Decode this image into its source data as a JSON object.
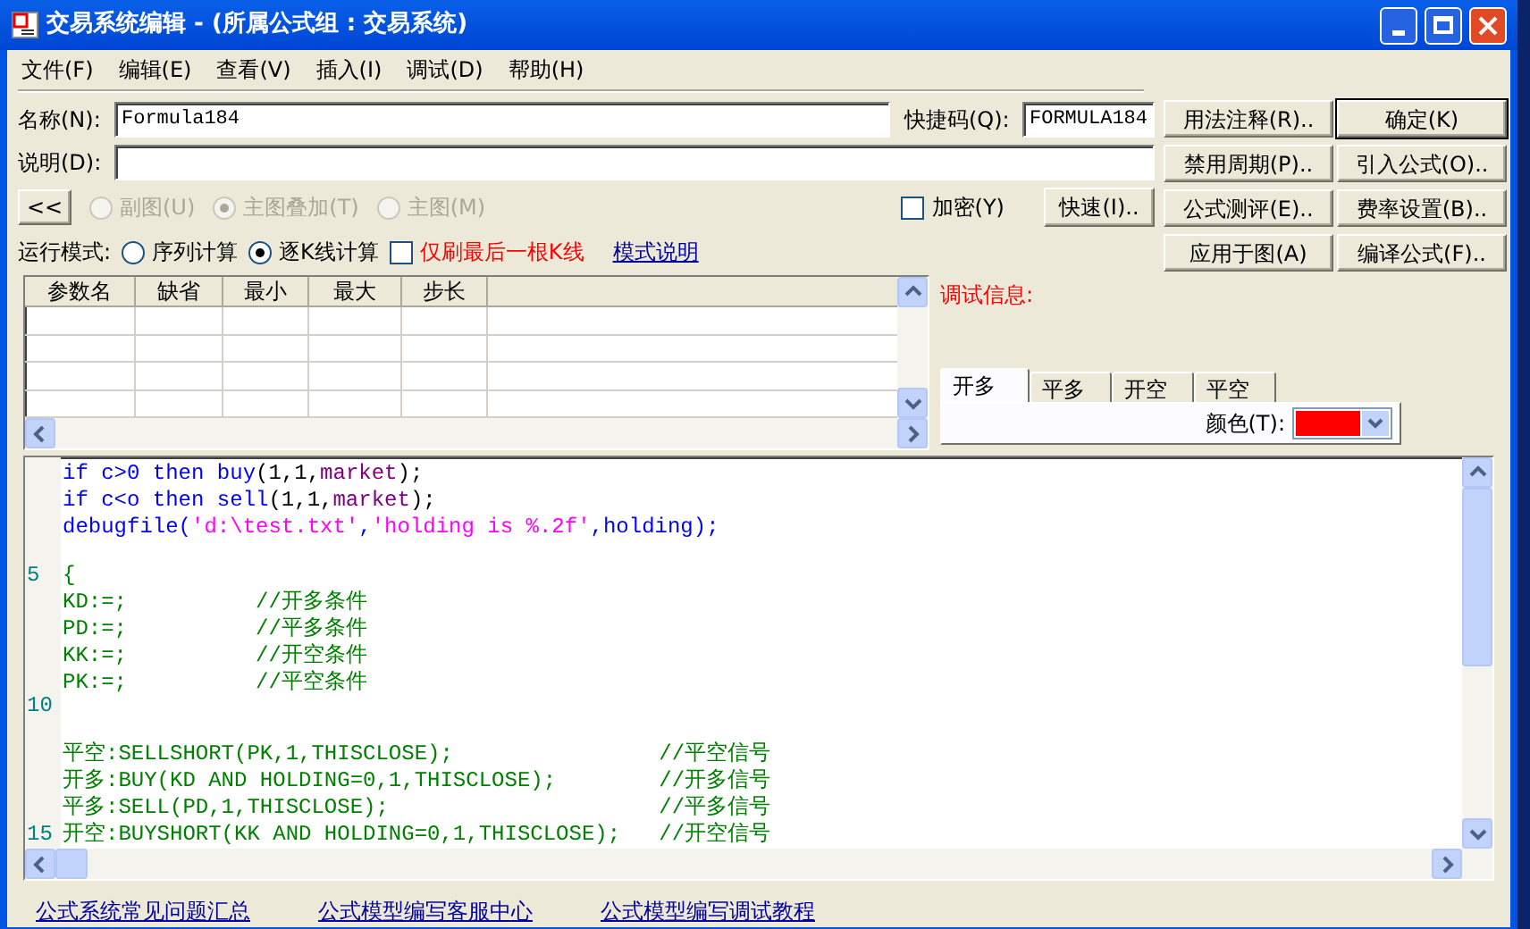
{
  "window": {
    "title": "交易系统编辑 - (所属公式组 : 交易系统)"
  },
  "menu": [
    "文件(F)",
    "编辑(E)",
    "查看(V)",
    "插入(I)",
    "调试(D)",
    "帮助(H)"
  ],
  "name_field": {
    "label": "名称(N):",
    "value": "Formula184"
  },
  "shortcut_field": {
    "label": "快捷码(Q):",
    "value": "FORMULA184"
  },
  "description_field": {
    "label": "说明(D):"
  },
  "collapse_button": "<<",
  "chart_modes": [
    {
      "label": "副图(U)",
      "selected": false,
      "disabled": true
    },
    {
      "label": "主图叠加(T)",
      "selected": true,
      "disabled": true
    },
    {
      "label": "主图(M)",
      "selected": false,
      "disabled": true
    }
  ],
  "encrypt": {
    "label": "加密(Y)",
    "checked": false
  },
  "fast_button": "快速(I)..",
  "run_mode": {
    "label": "运行模式:",
    "options": [
      {
        "label": "序列计算",
        "selected": false
      },
      {
        "label": "逐K线计算",
        "selected": true
      }
    ]
  },
  "last_bar_only": {
    "label": "仅刷最后一根K线",
    "checked": false
  },
  "mode_help_link": "模式说明",
  "right_buttons": [
    {
      "label": "用法注释(R)..",
      "default": false
    },
    {
      "label": "确定(K)",
      "default": true
    },
    {
      "label": "禁用周期(P)..",
      "default": false
    },
    {
      "label": "引入公式(O)..",
      "default": false
    },
    {
      "label": "公式测评(E)..",
      "default": false
    },
    {
      "label": "费率设置(B)..",
      "default": false
    },
    {
      "label": "应用于图(A)",
      "default": false
    },
    {
      "label": "编译公式(F)..",
      "default": false
    }
  ],
  "params_table": {
    "columns": [
      "参数名",
      "缺省",
      "最小",
      "最大",
      "步长"
    ]
  },
  "debug_label": "调试信息:",
  "signal_tabs": [
    {
      "label": "开多",
      "selected": true
    },
    {
      "label": "平多",
      "selected": false
    },
    {
      "label": "开空",
      "selected": false
    },
    {
      "label": "平空",
      "selected": false
    }
  ],
  "color_picker": {
    "label": "颜色(T):",
    "color": "#ff0000"
  },
  "editor": {
    "lines": [
      {
        "kind": "code",
        "tokens": [
          {
            "text": "if c>0 then buy",
            "kind": "keyword"
          },
          {
            "text": "(1,1,",
            "kind": "plain"
          },
          {
            "text": "market",
            "kind": "constant"
          },
          {
            "text": ");",
            "kind": "plain"
          }
        ]
      },
      {
        "kind": "code",
        "tokens": [
          {
            "text": "if c<o then sell",
            "kind": "keyword"
          },
          {
            "text": "(1,1,",
            "kind": "plain"
          },
          {
            "text": "market",
            "kind": "constant"
          },
          {
            "text": ");",
            "kind": "plain"
          }
        ]
      },
      {
        "kind": "code",
        "tokens": [
          {
            "text": "debugfile(",
            "kind": "keyword"
          },
          {
            "text": "'d:\\test.txt'",
            "kind": "string"
          },
          {
            "text": ",",
            "kind": "keyword"
          },
          {
            "text": "'holding is %.2f'",
            "kind": "string"
          },
          {
            "text": ",holding);",
            "kind": "keyword"
          }
        ]
      },
      {
        "kind": "blank"
      },
      {
        "kind": "code",
        "number": "5",
        "tokens": [
          {
            "text": "{",
            "kind": "comment"
          }
        ]
      },
      {
        "kind": "code",
        "tokens": [
          {
            "text": "KD:=;          //开多条件",
            "kind": "comment"
          }
        ]
      },
      {
        "kind": "code",
        "tokens": [
          {
            "text": "PD:=;          //平多条件",
            "kind": "comment"
          }
        ]
      },
      {
        "kind": "code",
        "tokens": [
          {
            "text": "KK:=;          //开空条件",
            "kind": "comment"
          }
        ]
      },
      {
        "kind": "code",
        "tokens": [
          {
            "text": "PK:=;          //平空条件",
            "kind": "comment"
          }
        ]
      },
      {
        "kind": "blank",
        "number": "10"
      },
      {
        "kind": "blank"
      },
      {
        "kind": "code",
        "tokens": [
          {
            "text": "平空:SELLSHORT(PK,1,THISCLOSE);                //平空信号",
            "kind": "comment"
          }
        ]
      },
      {
        "kind": "code",
        "tokens": [
          {
            "text": "开多:BUY(KD AND HOLDING=0,1,THISCLOSE);        //开多信号",
            "kind": "comment"
          }
        ]
      },
      {
        "kind": "code",
        "tokens": [
          {
            "text": "平多:SELL(PD,1,THISCLOSE);                     //平多信号",
            "kind": "comment"
          }
        ]
      },
      {
        "kind": "code",
        "number": "15",
        "tokens": [
          {
            "text": "开空:BUYSHORT(KK AND HOLDING=0,1,THISCLOSE);   //开空信号",
            "kind": "comment"
          }
        ]
      }
    ]
  },
  "footer_links": [
    "公式系统常见问题汇总",
    "公式模型编写客服中心",
    "公式模型编写调试教程"
  ]
}
